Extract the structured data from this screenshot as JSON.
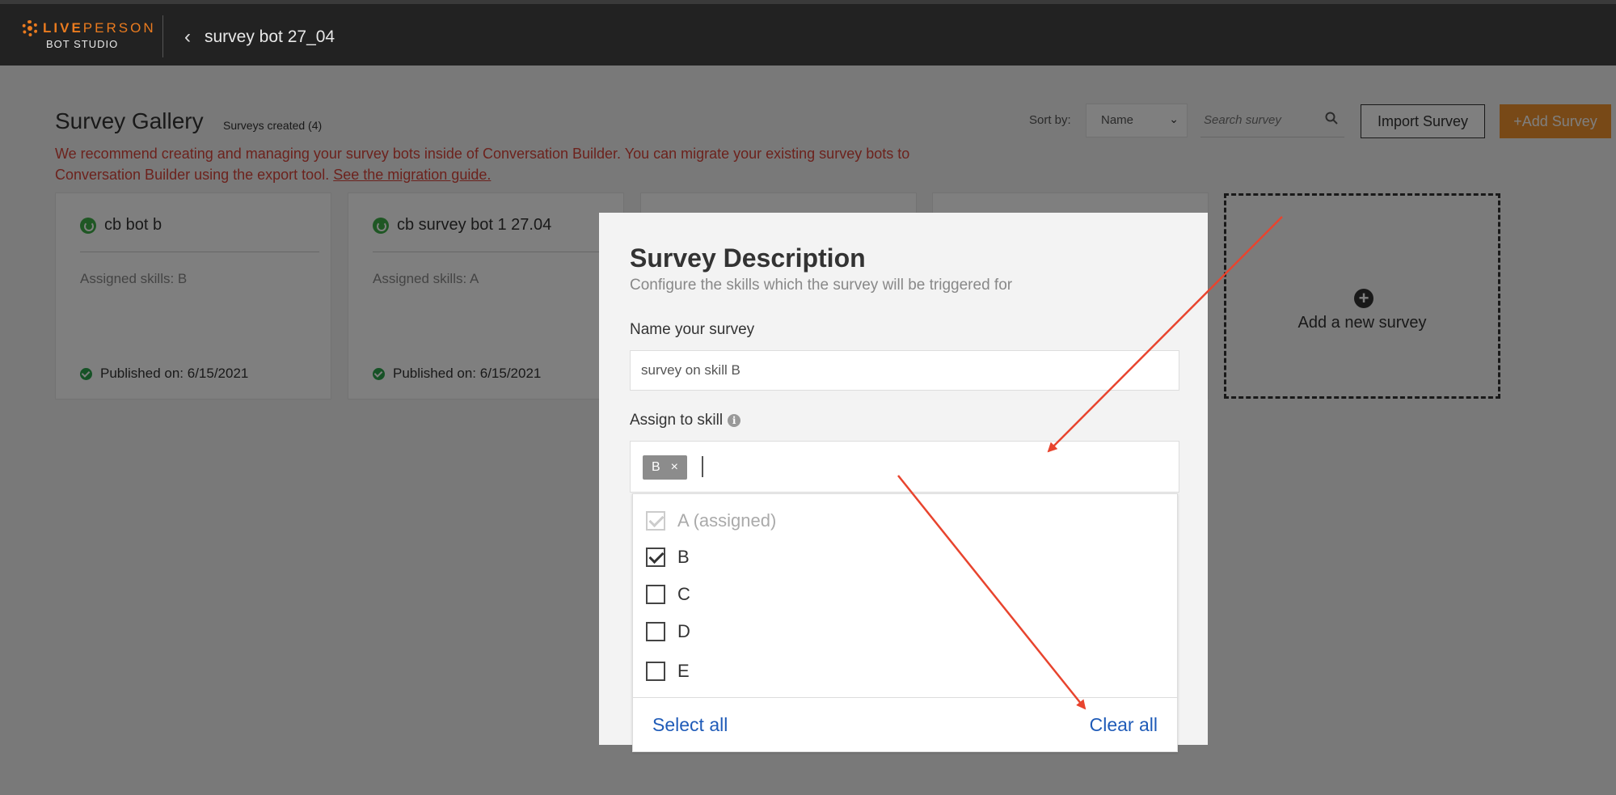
{
  "header": {
    "logo_brand": "LIVE",
    "logo_brand_thin": "PERSON",
    "logo_product": "BOT STUDIO",
    "bot_name": "survey bot 27_04"
  },
  "gallery": {
    "title": "Survey Gallery",
    "count_label": "Surveys created (4)",
    "notice_text": "We recommend creating and managing your survey bots inside of Conversation Builder. You can migrate your existing survey bots to Conversation Builder using the export tool.",
    "notice_link": "See the migration guide.",
    "sort_label": "Sort by:",
    "sort_value": "Name",
    "search_placeholder": "Search survey",
    "import_label": "Import Survey",
    "add_label": "+Add Survey",
    "add_card_label": "Add a new survey",
    "cards": [
      {
        "title": "cb bot b",
        "skills": "Assigned skills: B",
        "published": "Published on: 6/15/2021"
      },
      {
        "title": "cb survey bot 1 27.04",
        "skills": "Assigned skills: A",
        "published": "Published on: 6/15/2021"
      }
    ]
  },
  "modal": {
    "title": "Survey Description",
    "subtitle": "Configure the skills which the survey will be triggered for",
    "name_label": "Name your survey",
    "name_value": "survey on skill B",
    "skill_label": "Assign to skill",
    "info_glyph": "i",
    "selected_tag": "B",
    "tag_remove": "×",
    "options": [
      {
        "label": "A (assigned)",
        "state": "disabled-checked"
      },
      {
        "label": "B",
        "state": "checked"
      },
      {
        "label": "C",
        "state": "unchecked"
      },
      {
        "label": "D",
        "state": "unchecked"
      },
      {
        "label": "E",
        "state": "unchecked"
      }
    ],
    "select_all": "Select all",
    "clear_all": "Clear all"
  },
  "colors": {
    "topbar": "#222222",
    "brand_orange": "#ea7b1f",
    "add_button": "#f0922e",
    "notice_red": "#d9453a",
    "link_blue": "#1f5bb8",
    "status_green": "#3fae49",
    "annotation_arrow": "#e8442e"
  }
}
